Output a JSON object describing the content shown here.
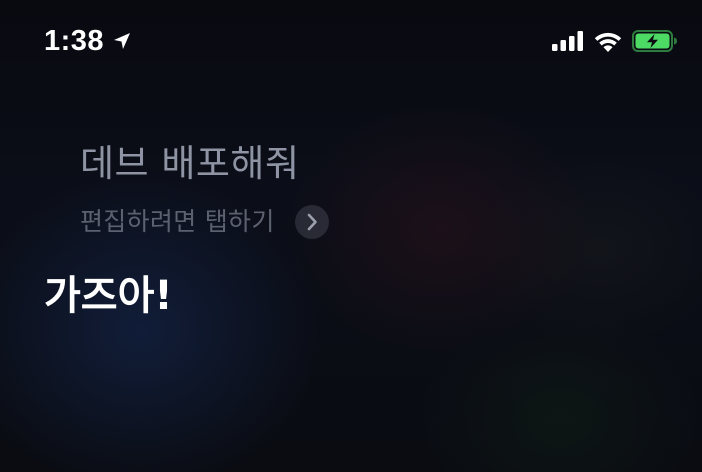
{
  "status_bar": {
    "time": "1:38",
    "location_icon": "location-arrow-icon",
    "signal_icon": "cellular-signal-icon",
    "wifi_icon": "wifi-icon",
    "battery_icon": "battery-charging-icon",
    "battery_color": "#4cd964"
  },
  "siri": {
    "query": "데브 배포해줘",
    "edit_hint": "편집하려면 탭하기",
    "edit_icon": "chevron-right-icon",
    "response": "가즈아!"
  }
}
